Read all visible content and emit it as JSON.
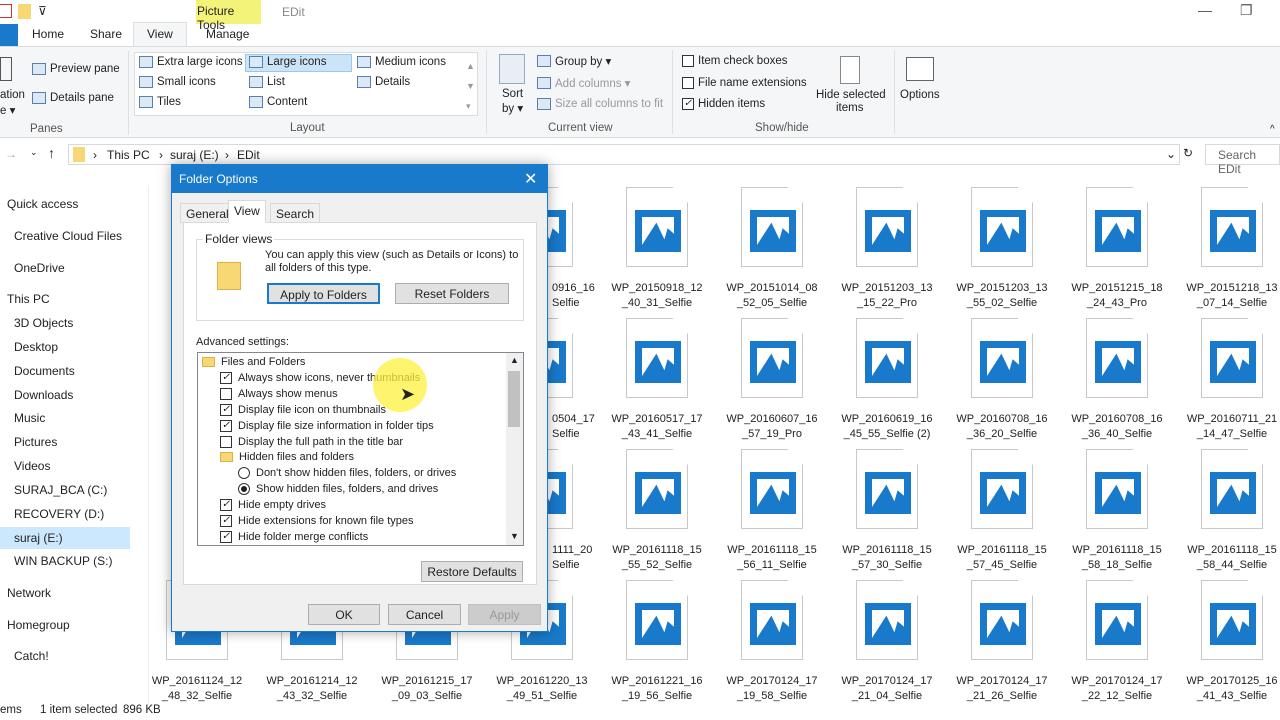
{
  "window": {
    "title": "EDit",
    "context_tab": "Picture Tools"
  },
  "ribbon_tabs": [
    "Home",
    "Share",
    "View",
    "Manage"
  ],
  "ribbon": {
    "panes": {
      "preview": "Preview pane",
      "details": "Details pane",
      "nav_partial": "ation",
      "nav_partial2": "e ▾",
      "group": "Panes"
    },
    "layout": {
      "items": [
        "Extra large icons",
        "Large icons",
        "Medium icons",
        "Small icons",
        "List",
        "Details",
        "Tiles",
        "Content"
      ],
      "selected": "Large icons",
      "group": "Layout"
    },
    "current_view": {
      "sort": "Sort",
      "sort2": "by ▾",
      "group_by": "Group by ▾",
      "add_columns": "Add columns ▾",
      "size_columns": "Size all columns to fit",
      "group": "Current view"
    },
    "show_hide": {
      "item_check": "Item check boxes",
      "item_check_on": false,
      "file_ext": "File name extensions",
      "file_ext_on": false,
      "hidden": "Hidden items",
      "hidden_on": true,
      "hide_selected": "Hide selected",
      "hide_selected2": "items",
      "group": "Show/hide"
    },
    "options": "Options"
  },
  "address": {
    "crumbs": [
      "This PC",
      "suraj (E:)",
      "EDit"
    ],
    "search_placeholder": "Search EDit"
  },
  "nav": [
    "Quick access",
    "Creative Cloud Files",
    "OneDrive",
    "This PC",
    "3D Objects",
    "Desktop",
    "Documents",
    "Downloads",
    "Music",
    "Pictures",
    "Videos",
    "SURAJ_BCA (C:)",
    "RECOVERY (D:)",
    "suraj (E:)",
    "WIN BACKUP (S:)",
    "Network",
    "Homegroup",
    "Catch!"
  ],
  "nav_selected": "suraj (E:)",
  "files": [
    [
      "0916_16",
      "Selfie"
    ],
    [
      "WP_20150918_12",
      "_40_31_Selfie"
    ],
    [
      "WP_20151014_08",
      "_52_05_Selfie"
    ],
    [
      "WP_20151203_13",
      "_15_22_Pro"
    ],
    [
      "WP_20151203_13",
      "_55_02_Selfie"
    ],
    [
      "WP_20151215_18",
      "_24_43_Pro"
    ],
    [
      "WP_20151218_13",
      "_07_14_Selfie"
    ],
    [
      "0504_17",
      "Selfie"
    ],
    [
      "WP_20160517_17",
      "_43_41_Selfie"
    ],
    [
      "WP_20160607_16",
      "_57_19_Pro"
    ],
    [
      "WP_20160619_16",
      "_45_55_Selfie (2)"
    ],
    [
      "WP_20160708_16",
      "_36_20_Selfie"
    ],
    [
      "WP_20160708_16",
      "_36_40_Selfie"
    ],
    [
      "WP_20160711_21",
      "_14_47_Selfie"
    ],
    [
      "1111_20",
      "Selfie"
    ],
    [
      "WP_20161118_15",
      "_55_52_Selfie"
    ],
    [
      "WP_20161118_15",
      "_56_11_Selfie"
    ],
    [
      "WP_20161118_15",
      "_57_30_Selfie"
    ],
    [
      "WP_20161118_15",
      "_57_45_Selfie"
    ],
    [
      "WP_20161118_15",
      "_58_18_Selfie"
    ],
    [
      "WP_20161118_15",
      "_58_44_Selfie"
    ],
    [
      "WP_20161124_12",
      "_48_32_Selfie"
    ],
    [
      "WP_20161214_12",
      "_43_32_Selfie"
    ],
    [
      "WP_20161215_17",
      "_09_03_Selfie"
    ],
    [
      "WP_20161220_13",
      "_49_51_Selfie"
    ],
    [
      "WP_20161221_16",
      "_19_56_Selfie"
    ],
    [
      "WP_20170124_17",
      "_19_58_Selfie"
    ],
    [
      "WP_20170124_17",
      "_21_04_Selfie"
    ],
    [
      "WP_20170124_17",
      "_21_26_Selfie"
    ],
    [
      "WP_20170124_17",
      "_22_12_Selfie"
    ],
    [
      "WP_20170125_16",
      "_41_43_Selfie"
    ]
  ],
  "status": {
    "items": "ems",
    "selected": "1 item selected",
    "size": "896 KB"
  },
  "dialog": {
    "title": "Folder Options",
    "tabs": [
      "General",
      "View",
      "Search"
    ],
    "active_tab": "View",
    "folder_views": {
      "legend": "Folder views",
      "text": "You can apply this view (such as Details or Icons) to all folders of this type.",
      "apply": "Apply to Folders",
      "reset": "Reset Folders"
    },
    "advanced_label": "Advanced settings:",
    "tree": [
      {
        "type": "folder",
        "label": "Files and Folders"
      },
      {
        "type": "check",
        "label": "Always show icons, never thumbnails",
        "checked": true
      },
      {
        "type": "check",
        "label": "Always show menus",
        "checked": false
      },
      {
        "type": "check",
        "label": "Display file icon on thumbnails",
        "checked": true
      },
      {
        "type": "check",
        "label": "Display file size information in folder tips",
        "checked": true
      },
      {
        "type": "check",
        "label": "Display the full path in the title bar",
        "checked": false
      },
      {
        "type": "subfolder",
        "label": "Hidden files and folders"
      },
      {
        "type": "radio",
        "label": "Don't show hidden files, folders, or drives",
        "checked": false
      },
      {
        "type": "radio",
        "label": "Show hidden files, folders, and drives",
        "checked": true
      },
      {
        "type": "check",
        "label": "Hide empty drives",
        "checked": true
      },
      {
        "type": "check",
        "label": "Hide extensions for known file types",
        "checked": true
      },
      {
        "type": "check",
        "label": "Hide folder merge conflicts",
        "checked": true
      }
    ],
    "restore": "Restore Defaults",
    "ok": "OK",
    "cancel": "Cancel",
    "apply": "Apply"
  },
  "colors": {
    "accent": "#1979ca",
    "context_tab": "#f3f37a",
    "selection": "#cce8ff"
  }
}
